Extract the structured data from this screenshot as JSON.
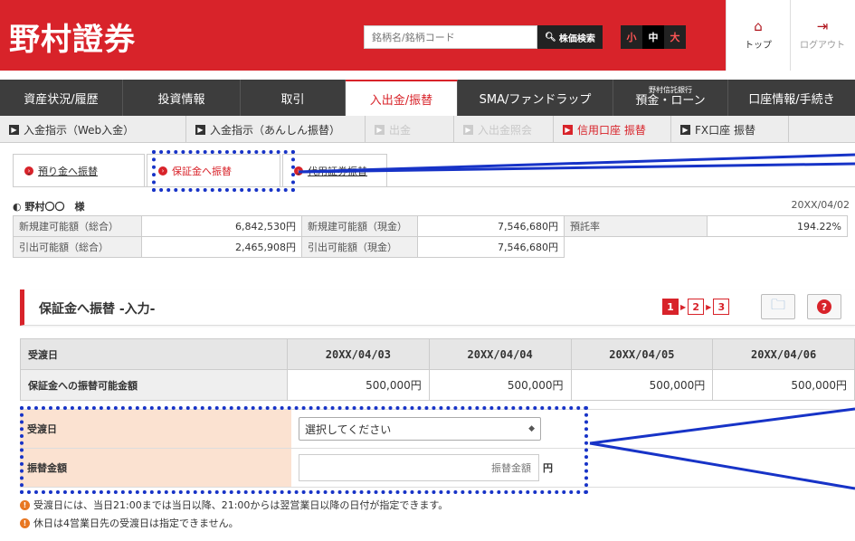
{
  "header": {
    "logo": "野村證券",
    "search_placeholder": "銘柄名/銘柄コード",
    "search_button": "株価検索",
    "font_size": {
      "small": "小",
      "medium": "中",
      "large": "大"
    },
    "top_label": "トップ",
    "logout_label": "ログアウト"
  },
  "mainnav": [
    {
      "label": "資産状況/履歴"
    },
    {
      "label": "投資情報"
    },
    {
      "label": "取引"
    },
    {
      "label": "入出金/振替"
    },
    {
      "label": "SMA/ファンドラップ"
    },
    {
      "label_small": "野村信託銀行",
      "label": "預金・ローン"
    },
    {
      "label": "口座情報/手続き"
    }
  ],
  "subnav": [
    {
      "label": "入金指示（Web入金）"
    },
    {
      "label": "入金指示（あんしん振替）"
    },
    {
      "label": "出金"
    },
    {
      "label": "入出金照会"
    },
    {
      "label": "信用口座 振替"
    },
    {
      "label": "FX口座 振替"
    }
  ],
  "tabs": [
    {
      "label": "預り金へ振替"
    },
    {
      "label": "保証金へ振替"
    },
    {
      "label": "代用証券振替"
    }
  ],
  "customer": "野村〇〇　様",
  "current_date": "20XX/04/02",
  "summary": {
    "row1": [
      {
        "label": "新規建可能額（総合）",
        "value": "6,842,530円"
      },
      {
        "label": "新規建可能額（現金）",
        "value": "7,546,680円"
      },
      {
        "label": "預託率",
        "value": "194.22%"
      }
    ],
    "row2": [
      {
        "label": "引出可能額（総合）",
        "value": "2,465,908円"
      },
      {
        "label": "引出可能額（現金）",
        "value": "7,546,680円"
      }
    ]
  },
  "section": {
    "title": "保証金へ振替 -入力-",
    "steps": [
      "1",
      "2",
      "3"
    ]
  },
  "dates_table": {
    "header_label": "受渡日",
    "dates": [
      "20XX/04/03",
      "20XX/04/04",
      "20XX/04/05",
      "20XX/04/06"
    ],
    "row_label": "保証金への振替可能金額",
    "amounts": [
      "500,000円",
      "500,000円",
      "500,000円",
      "500,000円"
    ]
  },
  "form": {
    "date_label": "受渡日",
    "date_select": "選択してください",
    "amount_label": "振替金額",
    "amount_placeholder": "振替金額",
    "amount_unit": "円"
  },
  "notes": [
    "受渡日には、当日21:00までは当日以降、21:00からは翌営業日以降の日付が指定できます。",
    "休日は4営業日先の受渡日は指定できません。"
  ]
}
